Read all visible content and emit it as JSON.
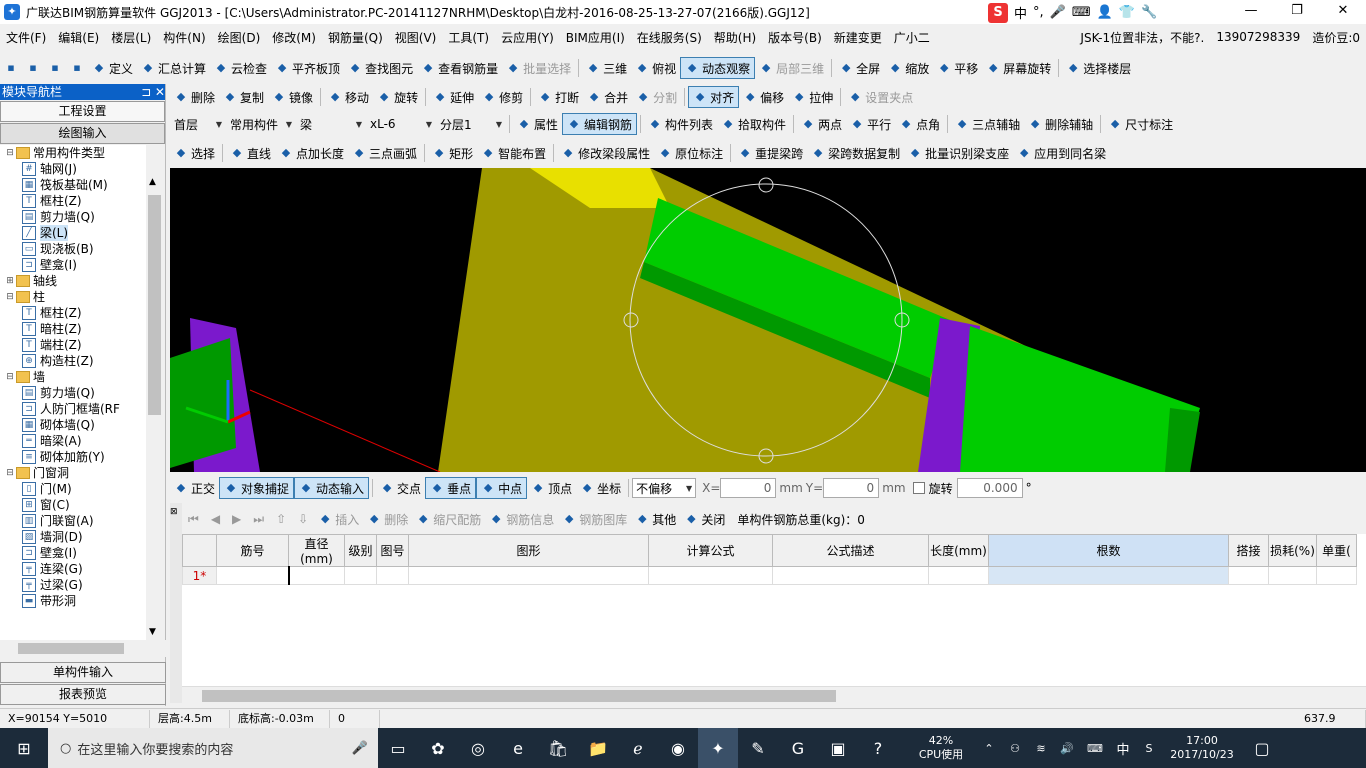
{
  "window": {
    "title": "广联达BIM钢筋算量软件 GGJ2013 - [C:\\Users\\Administrator.PC-20141127NRHM\\Desktop\\白龙村-2016-08-25-13-27-07(2166版).GGJ12]",
    "ime_label": "中"
  },
  "menu": [
    "文件(F)",
    "编辑(E)",
    "楼层(L)",
    "构件(N)",
    "绘图(D)",
    "修改(M)",
    "钢筋量(Q)",
    "视图(V)",
    "工具(T)",
    "云应用(Y)",
    "BIM应用(I)",
    "在线服务(S)",
    "帮助(H)",
    "版本号(B)",
    "新建变更",
    "广小二"
  ],
  "menu_right": {
    "notice": "JSK-1位置非法，不能?.",
    "phone": "13907298339",
    "cost": "造价豆:0"
  },
  "toolbar1": [
    "定义",
    "汇总计算",
    "云检查",
    "平齐板顶",
    "查找图元",
    "查看钢筋量",
    "批量选择",
    "三维",
    "俯视",
    "动态观察",
    "局部三维",
    "全屏",
    "缩放",
    "平移",
    "屏幕旋转",
    "选择楼层"
  ],
  "toolbar2": [
    "删除",
    "复制",
    "镜像",
    "移动",
    "旋转",
    "延伸",
    "修剪",
    "打断",
    "合并",
    "分割",
    "对齐",
    "偏移",
    "拉伸",
    "设置夹点"
  ],
  "toolbar3": {
    "floor": "首层",
    "category": "常用构件",
    "type": "梁",
    "element": "xL-6",
    "layer": "分层1",
    "buttons": [
      "属性",
      "编辑钢筋",
      "构件列表",
      "拾取构件",
      "两点",
      "平行",
      "点角",
      "三点辅轴",
      "删除辅轴",
      "尺寸标注"
    ]
  },
  "toolbar4": [
    "选择",
    "直线",
    "点加长度",
    "三点画弧",
    "矩形",
    "智能布置",
    "修改梁段属性",
    "原位标注",
    "重提梁跨",
    "梁跨数据复制",
    "批量识别梁支座",
    "应用到同名梁"
  ],
  "nav": {
    "header": "模块导航栏",
    "btn_project": "工程设置",
    "btn_draw": "绘图输入",
    "btn_single": "单构件输入",
    "btn_report": "报表预览"
  },
  "tree": [
    {
      "level": 0,
      "exp": "⊟",
      "folder": true,
      "label": "常用构件类型"
    },
    {
      "level": 1,
      "icon": "#",
      "label": "轴网(J)"
    },
    {
      "level": 1,
      "icon": "▦",
      "label": "筏板基础(M)"
    },
    {
      "level": 1,
      "icon": "T",
      "label": "框柱(Z)"
    },
    {
      "level": 1,
      "icon": "▤",
      "label": "剪力墙(Q)"
    },
    {
      "level": 1,
      "icon": "╱",
      "label": "梁(L)",
      "sel": true
    },
    {
      "level": 1,
      "icon": "▭",
      "label": "现浇板(B)"
    },
    {
      "level": 1,
      "icon": "⊐",
      "label": "壁龛(I)"
    },
    {
      "level": 0,
      "exp": "⊞",
      "folder": true,
      "label": "轴线"
    },
    {
      "level": 0,
      "exp": "⊟",
      "folder": true,
      "label": "柱"
    },
    {
      "level": 1,
      "icon": "T",
      "label": "框柱(Z)"
    },
    {
      "level": 1,
      "icon": "T",
      "label": "暗柱(Z)"
    },
    {
      "level": 1,
      "icon": "T",
      "label": "端柱(Z)"
    },
    {
      "level": 1,
      "icon": "⊕",
      "label": "构造柱(Z)"
    },
    {
      "level": 0,
      "exp": "⊟",
      "folder": true,
      "label": "墙"
    },
    {
      "level": 1,
      "icon": "▤",
      "label": "剪力墙(Q)"
    },
    {
      "level": 1,
      "icon": "⊐",
      "label": "人防门框墙(RF"
    },
    {
      "level": 1,
      "icon": "▦",
      "label": "砌体墙(Q)"
    },
    {
      "level": 1,
      "icon": "═",
      "label": "暗梁(A)"
    },
    {
      "level": 1,
      "icon": "≡",
      "label": "砌体加筋(Y)"
    },
    {
      "level": 0,
      "exp": "⊟",
      "folder": true,
      "label": "门窗洞"
    },
    {
      "level": 1,
      "icon": "▯",
      "label": "门(M)"
    },
    {
      "level": 1,
      "icon": "⊞",
      "label": "窗(C)"
    },
    {
      "level": 1,
      "icon": "▥",
      "label": "门联窗(A)"
    },
    {
      "level": 1,
      "icon": "▨",
      "label": "墙洞(D)"
    },
    {
      "level": 1,
      "icon": "⊐",
      "label": "壁龛(I)"
    },
    {
      "level": 1,
      "icon": "╤",
      "label": "连梁(G)"
    },
    {
      "level": 1,
      "icon": "╤",
      "label": "过梁(G)"
    },
    {
      "level": 1,
      "icon": "▬",
      "label": "带形洞"
    }
  ],
  "snapbar": {
    "items": [
      "正交",
      "对象捕捉",
      "动态输入",
      "交点",
      "垂点",
      "中点",
      "顶点",
      "坐标"
    ],
    "offset": "不偏移",
    "x_label": "X=",
    "x_val": "0",
    "unit": "mm",
    "y_label": "Y=",
    "y_val": "0",
    "unit2": "mm",
    "rot_label": "旋转",
    "rot_val": "0.000",
    "deg": "°"
  },
  "tablebar": {
    "items": [
      "插入",
      "删除",
      "缩尺配筋",
      "钢筋信息",
      "钢筋图库",
      "其他",
      "关闭"
    ],
    "total": "单构件钢筋总重(kg)：0"
  },
  "grid": {
    "headers": [
      "筋号",
      "直径(mm)",
      "级别",
      "图号",
      "图形",
      "计算公式",
      "公式描述",
      "长度(mm)",
      "根数",
      "搭接",
      "损耗(%)",
      "单重("
    ],
    "row_label": "1*"
  },
  "status": {
    "coords": "X=90154 Y=5010",
    "floor_h": "层高:4.5m",
    "base_h": "底标高:-0.03m",
    "zero": "0",
    "fps": "637.9 FPS"
  },
  "taskbar": {
    "search": "在这里输入你要搜索的内容",
    "cpu_pct": "42%",
    "cpu_label": "CPU使用",
    "lang": "中",
    "time": "17:00",
    "date": "2017/10/23"
  },
  "colors": {
    "accent": "#0b61c7",
    "beam_green": "#00cc00",
    "slab_yellow": "#a09a00",
    "column_purple": "#7b19cc"
  }
}
